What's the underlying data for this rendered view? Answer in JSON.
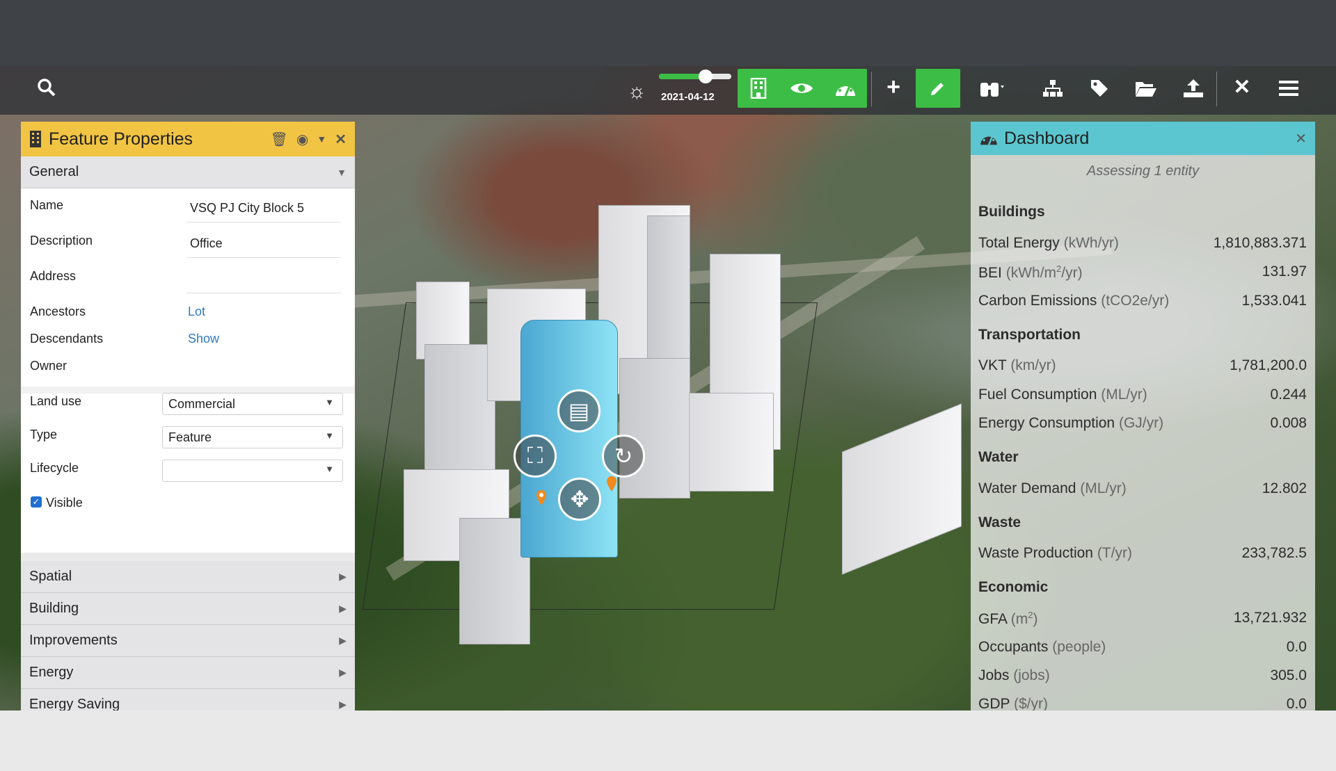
{
  "toolbar": {
    "date": "2021-04-12",
    "icons": [
      "search-icon",
      "brightness-icon",
      "building-icon",
      "eye-icon",
      "dashboard-icon",
      "plus-icon",
      "pencil-icon",
      "binoculars-icon",
      "hierarchy-icon",
      "tag-icon",
      "folder-open-icon",
      "upload-icon",
      "close-icon",
      "menu-icon"
    ]
  },
  "feature_properties": {
    "title": "Feature Properties",
    "general_label": "General",
    "fields": {
      "name_label": "Name",
      "name_value": "VSQ PJ City Block 5",
      "description_label": "Description",
      "description_value": "Office",
      "address_label": "Address",
      "ancestors_label": "Ancestors",
      "ancestors_value": "Lot",
      "descendants_label": "Descendants",
      "descendants_value": "Show",
      "owner_label": "Owner",
      "land_use_label": "Land use",
      "land_use_value": "Commercial",
      "type_label": "Type",
      "type_value": "Feature",
      "lifecycle_label": "Lifecycle",
      "lifecycle_value": "",
      "visible_label": "Visible"
    },
    "sections": [
      "Spatial",
      "Building",
      "Improvements",
      "Energy",
      "Energy Saving"
    ]
  },
  "dashboard": {
    "title": "Dashboard",
    "subtitle": "Assessing 1 entity",
    "groups": {
      "buildings": "Buildings",
      "transportation": "Transportation",
      "water": "Water",
      "waste": "Waste",
      "economic": "Economic"
    },
    "rows": {
      "total_energy": {
        "label": "Total Energy",
        "unit": "(kWh/yr)",
        "value": "1,810,883.371"
      },
      "bei": {
        "label": "BEI",
        "unit_pre": "(kWh/m",
        "unit_sup": "2",
        "unit_post": "/yr)",
        "value": "131.97"
      },
      "carbon": {
        "label": "Carbon Emissions",
        "unit": "(tCO2e/yr)",
        "value": "1,533.041"
      },
      "vkt": {
        "label": "VKT",
        "unit": "(km/yr)",
        "value": "1,781,200.0"
      },
      "fuel": {
        "label": "Fuel Consumption",
        "unit": "(ML/yr)",
        "value": "0.244"
      },
      "energy_cons": {
        "label": "Energy Consumption",
        "unit": "(GJ/yr)",
        "value": "0.008"
      },
      "water_demand": {
        "label": "Water Demand",
        "unit": "(ML/yr)",
        "value": "12.802"
      },
      "waste_prod": {
        "label": "Waste Production",
        "unit": "(T/yr)",
        "value": "233,782.5"
      },
      "gfa": {
        "label": "GFA",
        "unit_pre": "(m",
        "unit_sup": "2",
        "unit_post": ")",
        "value": "13,721.932"
      },
      "occupants": {
        "label": "Occupants",
        "unit": "(people)",
        "value": "0.0"
      },
      "jobs": {
        "label": "Jobs",
        "unit": "(jobs)",
        "value": "305.0"
      },
      "gdp": {
        "label": "GDP",
        "unit": "($/yr)",
        "value": "0.0"
      }
    }
  },
  "colors": {
    "feature_header": "#f1c443",
    "dashboard_header": "#5bc6cf",
    "accent_green": "#3cbd46",
    "selected_building": "#8fe3f5"
  }
}
